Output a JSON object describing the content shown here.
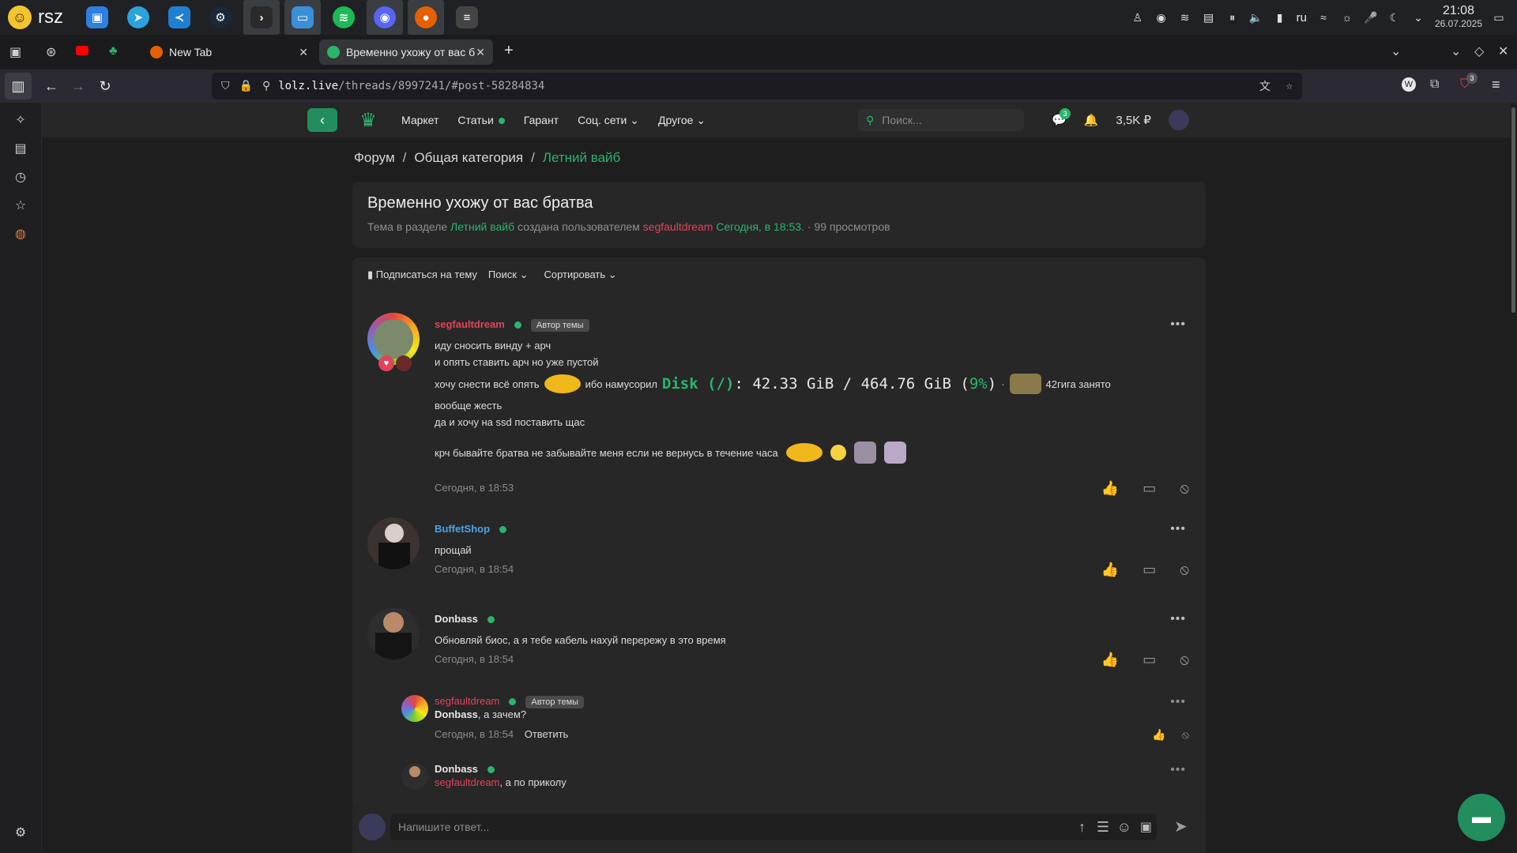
{
  "taskbar": {
    "start_label": "rsz",
    "apps": [
      "Store",
      "Telegram",
      "VS Code",
      "Steam",
      "Terminal",
      "Files",
      "Spotify",
      "Discord",
      "Firefox",
      "Mixer"
    ],
    "tray_lang": "ru",
    "time": "21:08",
    "date": "26.07.2025"
  },
  "tabs": [
    {
      "label": "New Tab"
    },
    {
      "label": "Временно ухожу от вас б"
    }
  ],
  "url": {
    "host": "lolz.live",
    "path": "/threads/8997241/#post-58284834"
  },
  "site": {
    "nav": [
      "Маркет",
      "Статьи",
      "Гарант",
      "Соц. сети",
      "Другое"
    ],
    "search_placeholder": "Поиск...",
    "messages_badge": "3",
    "balance": "3,5K ₽",
    "ext_badge": "3"
  },
  "breadcrumb": [
    "Форум",
    "Общая категория",
    "Летний вайб"
  ],
  "thread": {
    "title": "Временно ухожу от вас братва",
    "meta_prefix": "Тема в разделе",
    "section": "Летний вайб",
    "created_by": "создана пользователем",
    "author": "segfaultdream",
    "date": "Сегодня, в 18:53.",
    "views": "99 просмотров"
  },
  "toolbar": {
    "subscribe": "Подписаться на тему",
    "search": "Поиск",
    "sort": "Сортировать"
  },
  "posts": [
    {
      "author": "segfaultdream",
      "badge": "Автор темы",
      "lines": [
        "иду сносить винду + арч",
        "и опять ставить арч но уже пустой"
      ],
      "line3a": "хочу снести всё опять",
      "line3b": "ибо намусорил",
      "disk_label": "Disk (/)",
      "disk_value": ": 42.33 GiB / 464.76 GiB (",
      "disk_pct": "9%",
      "disk_close": ")",
      "line3c": "42гига занято",
      "lines2": [
        "вообще жесть",
        "да и хочу на ssd поставить щас"
      ],
      "line_last": "крч бывайте братва не забывайте меня если не вернусь в течение часа",
      "time": "Сегодня, в 18:53"
    },
    {
      "author": "BuffetShop",
      "text": "прощай",
      "time": "Сегодня, в 18:54"
    },
    {
      "author": "Donbass",
      "text": "Обновляй биос, а я тебе кабель нахуй перережу в это время",
      "time": "Сегодня, в 18:54"
    }
  ],
  "replies": [
    {
      "author": "segfaultdream",
      "badge": "Автор темы",
      "mention": "Donbass",
      "text": ", а зачем?",
      "time": "Сегодня, в 18:54",
      "reply": "Ответить"
    },
    {
      "author": "Donbass",
      "mention": "segfaultdream",
      "text": ", а по приколу"
    }
  ],
  "composer": {
    "placeholder": "Напишите ответ..."
  },
  "colors": {
    "accent": "#2bb46a",
    "author_red": "#e0445a",
    "link_blue": "#4aa3e8"
  }
}
